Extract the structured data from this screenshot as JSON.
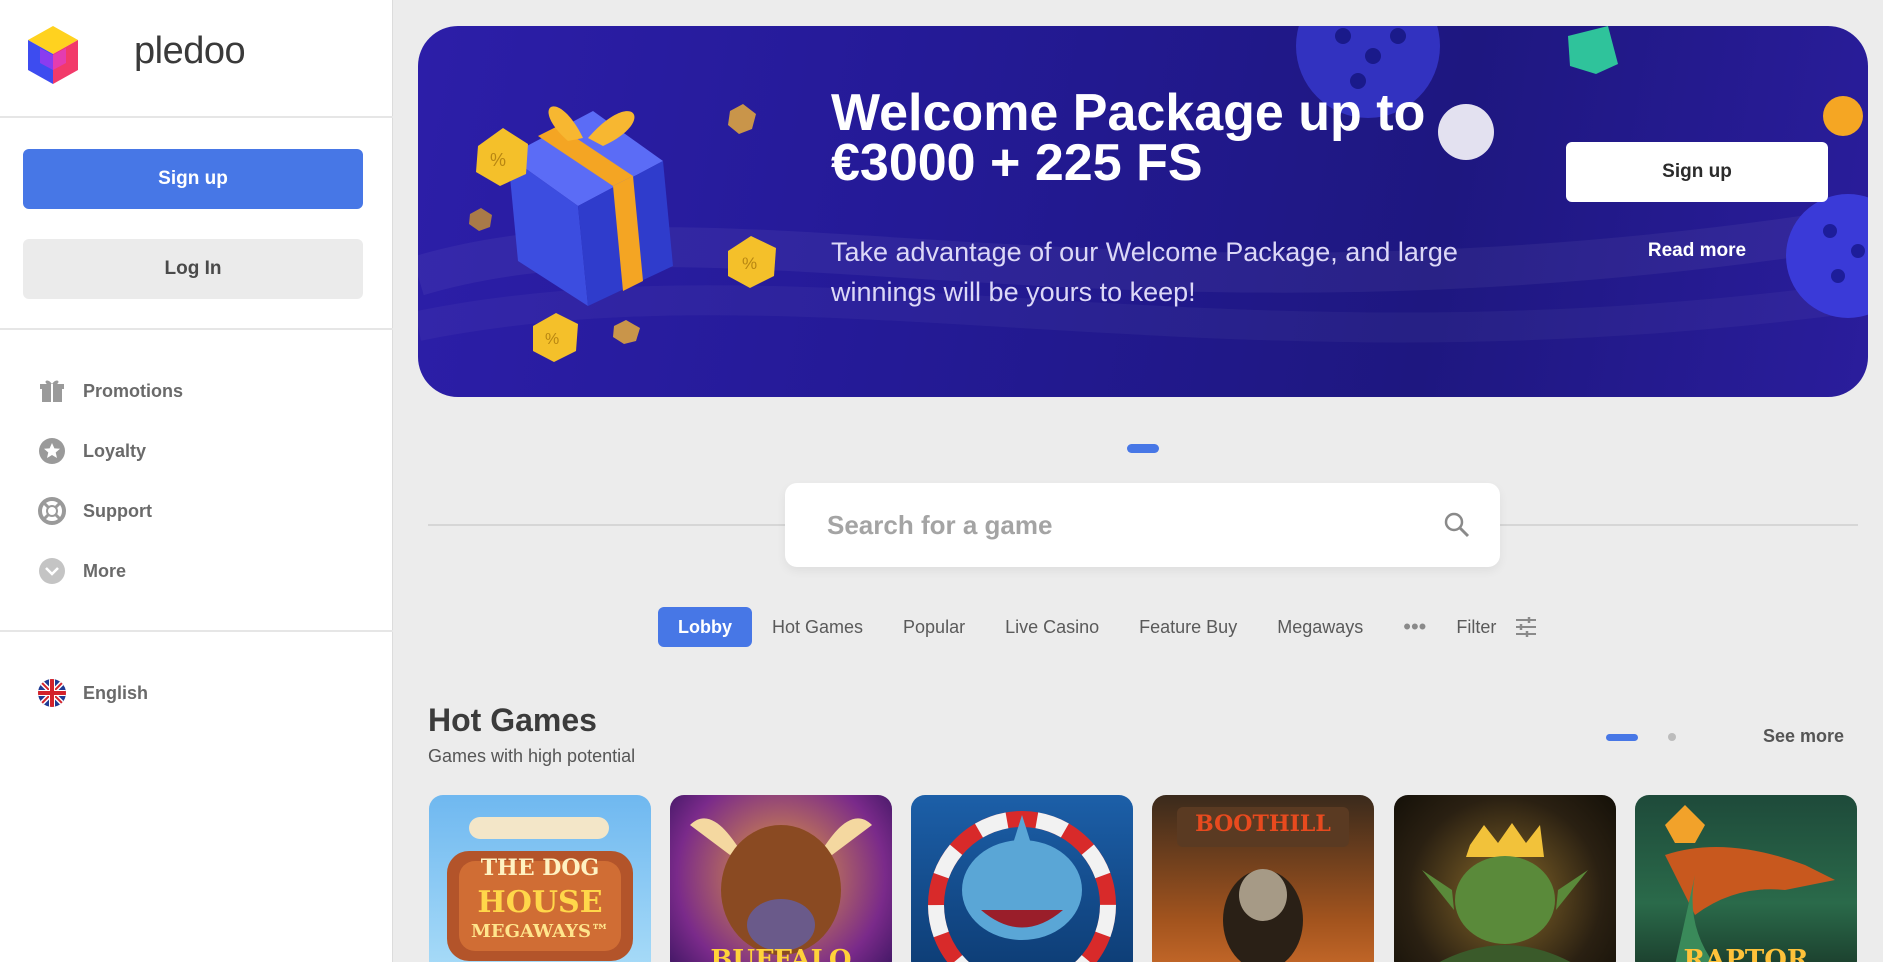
{
  "brand": {
    "name": "pledoo"
  },
  "sidebar": {
    "signup_label": "Sign up",
    "login_label": "Log In",
    "items": [
      {
        "label": "Promotions",
        "icon": "gift-icon"
      },
      {
        "label": "Loyalty",
        "icon": "star-icon"
      },
      {
        "label": "Support",
        "icon": "lifebuoy-icon"
      },
      {
        "label": "More",
        "icon": "chevron-down-icon"
      }
    ],
    "language": {
      "label": "English",
      "icon": "uk-flag-icon"
    }
  },
  "banner": {
    "title": "Welcome Package up to €3000 + 225 FS",
    "subtitle": "Take advantage of our Welcome Package, and large winnings will be yours to keep!",
    "signup_label": "Sign up",
    "read_more_label": "Read more"
  },
  "search": {
    "placeholder": "Search for a game"
  },
  "tabs": {
    "items": [
      "Lobby",
      "Hot Games",
      "Popular",
      "Live Casino",
      "Feature Buy",
      "Megaways"
    ],
    "active": "Lobby",
    "more_label": "•••",
    "filter_label": "Filter"
  },
  "hot_games": {
    "title": "Hot Games",
    "subtitle": "Games with high potential",
    "see_more_label": "See more",
    "games": [
      {
        "text_line1": "THE DOG",
        "text_line2": "HOUSE",
        "text_line3": "MEGAWAYS™"
      },
      {
        "text_line1": "BUFFALO"
      },
      {
        "text_line1": ""
      },
      {
        "text_line1": "BOOTHILL"
      },
      {
        "text_line1": ""
      },
      {
        "text_line1": "RAPTOR"
      }
    ]
  },
  "colors": {
    "accent": "#4777e6",
    "banner": "#241a96",
    "background": "#ececec"
  }
}
